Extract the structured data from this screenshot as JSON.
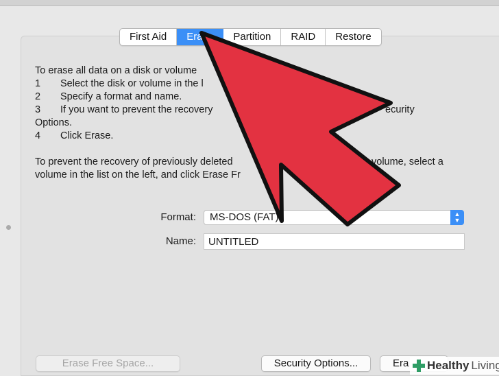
{
  "tabs": [
    {
      "label": "First Aid",
      "active": false
    },
    {
      "label": "Erase",
      "active": true
    },
    {
      "label": "Partition",
      "active": false
    },
    {
      "label": "RAID",
      "active": false
    },
    {
      "label": "Restore",
      "active": false
    }
  ],
  "instructions": {
    "intro": "To erase all data on a disk or volume",
    "steps": [
      {
        "num": "1",
        "text": "Select the disk or volume in the l"
      },
      {
        "num": "2",
        "text": "Specify a format and name."
      },
      {
        "num": "3",
        "text": "If you want to prevent the recovery"
      },
      {
        "num": "",
        "text": "Options."
      },
      {
        "num": "4",
        "text": "Click Erase."
      }
    ],
    "step3_tail": "ecurity",
    "para2_line1_start": "To prevent the recovery of previously deleted",
    "para2_line1_end": "volume, select a",
    "para2_line2": "volume in the list on the left, and click Erase Fr"
  },
  "form": {
    "format_label": "Format:",
    "format_value": "MS-DOS (FAT)",
    "name_label": "Name:",
    "name_value": "UNTITLED"
  },
  "buttons": {
    "erase_free_space": "Erase Free Space...",
    "security_options": "Security Options...",
    "erase": "Era"
  },
  "watermark": {
    "brand_bold": "Healthy",
    "brand_light": "Living"
  },
  "colors": {
    "accent": "#3b8ff7",
    "arrow_fill": "#e33241",
    "arrow_stroke": "#111111"
  }
}
